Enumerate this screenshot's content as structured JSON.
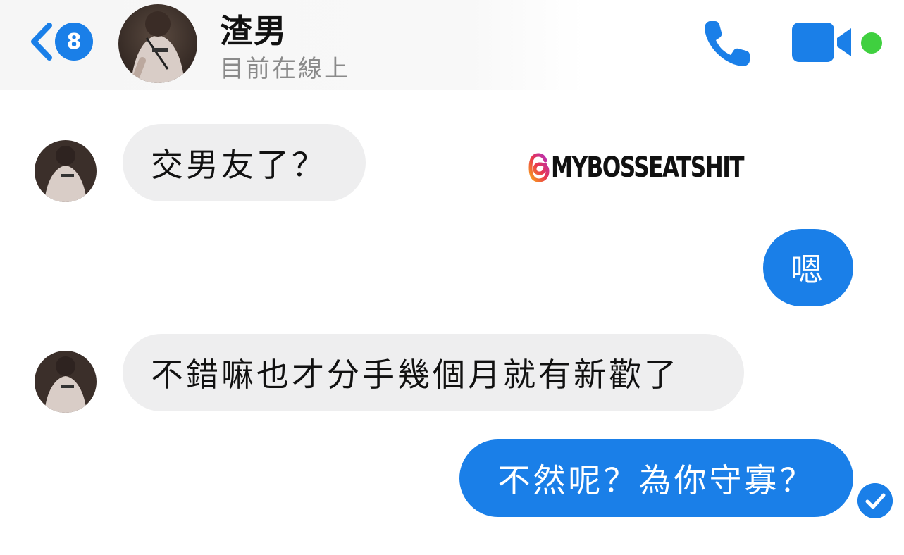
{
  "header": {
    "unread_count": "8",
    "contact_name": "渣男",
    "contact_status": "目前在線上"
  },
  "watermark": {
    "text": "MYBOSSEATSHIT"
  },
  "messages": [
    {
      "sender": "them",
      "text": "交男友了？"
    },
    {
      "sender": "me",
      "text": "嗯"
    },
    {
      "sender": "them",
      "text": "不錯嘛也才分手幾個月就有新歡了"
    },
    {
      "sender": "me",
      "text": "不然呢？為你守寡？"
    }
  ],
  "colors": {
    "accent": "#1a7fe8",
    "incoming_bubble": "#eeeeef",
    "online": "#3fd03f"
  },
  "icons": {
    "back": "chevron-left-icon",
    "call": "phone-icon",
    "video": "video-camera-icon",
    "read": "read-check-icon",
    "watermark": "threads-logo-icon"
  }
}
